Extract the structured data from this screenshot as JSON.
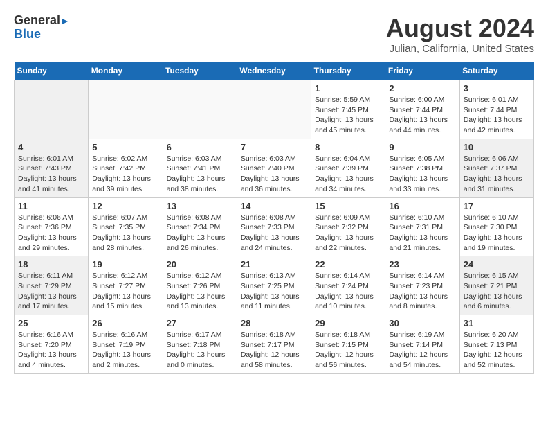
{
  "header": {
    "logo_line1": "General",
    "logo_line2": "Blue",
    "month_year": "August 2024",
    "location": "Julian, California, United States"
  },
  "weekdays": [
    "Sunday",
    "Monday",
    "Tuesday",
    "Wednesday",
    "Thursday",
    "Friday",
    "Saturday"
  ],
  "weeks": [
    [
      {
        "day": "",
        "sunrise": "",
        "sunset": "",
        "daylight": "",
        "empty": true
      },
      {
        "day": "",
        "sunrise": "",
        "sunset": "",
        "daylight": "",
        "empty": true
      },
      {
        "day": "",
        "sunrise": "",
        "sunset": "",
        "daylight": "",
        "empty": true
      },
      {
        "day": "",
        "sunrise": "",
        "sunset": "",
        "daylight": "",
        "empty": true
      },
      {
        "day": "1",
        "sunrise": "Sunrise: 5:59 AM",
        "sunset": "Sunset: 7:45 PM",
        "daylight": "Daylight: 13 hours and 45 minutes.",
        "empty": false
      },
      {
        "day": "2",
        "sunrise": "Sunrise: 6:00 AM",
        "sunset": "Sunset: 7:44 PM",
        "daylight": "Daylight: 13 hours and 44 minutes.",
        "empty": false
      },
      {
        "day": "3",
        "sunrise": "Sunrise: 6:01 AM",
        "sunset": "Sunset: 7:44 PM",
        "daylight": "Daylight: 13 hours and 42 minutes.",
        "empty": false
      }
    ],
    [
      {
        "day": "4",
        "sunrise": "Sunrise: 6:01 AM",
        "sunset": "Sunset: 7:43 PM",
        "daylight": "Daylight: 13 hours and 41 minutes.",
        "empty": false
      },
      {
        "day": "5",
        "sunrise": "Sunrise: 6:02 AM",
        "sunset": "Sunset: 7:42 PM",
        "daylight": "Daylight: 13 hours and 39 minutes.",
        "empty": false
      },
      {
        "day": "6",
        "sunrise": "Sunrise: 6:03 AM",
        "sunset": "Sunset: 7:41 PM",
        "daylight": "Daylight: 13 hours and 38 minutes.",
        "empty": false
      },
      {
        "day": "7",
        "sunrise": "Sunrise: 6:03 AM",
        "sunset": "Sunset: 7:40 PM",
        "daylight": "Daylight: 13 hours and 36 minutes.",
        "empty": false
      },
      {
        "day": "8",
        "sunrise": "Sunrise: 6:04 AM",
        "sunset": "Sunset: 7:39 PM",
        "daylight": "Daylight: 13 hours and 34 minutes.",
        "empty": false
      },
      {
        "day": "9",
        "sunrise": "Sunrise: 6:05 AM",
        "sunset": "Sunset: 7:38 PM",
        "daylight": "Daylight: 13 hours and 33 minutes.",
        "empty": false
      },
      {
        "day": "10",
        "sunrise": "Sunrise: 6:06 AM",
        "sunset": "Sunset: 7:37 PM",
        "daylight": "Daylight: 13 hours and 31 minutes.",
        "empty": false
      }
    ],
    [
      {
        "day": "11",
        "sunrise": "Sunrise: 6:06 AM",
        "sunset": "Sunset: 7:36 PM",
        "daylight": "Daylight: 13 hours and 29 minutes.",
        "empty": false
      },
      {
        "day": "12",
        "sunrise": "Sunrise: 6:07 AM",
        "sunset": "Sunset: 7:35 PM",
        "daylight": "Daylight: 13 hours and 28 minutes.",
        "empty": false
      },
      {
        "day": "13",
        "sunrise": "Sunrise: 6:08 AM",
        "sunset": "Sunset: 7:34 PM",
        "daylight": "Daylight: 13 hours and 26 minutes.",
        "empty": false
      },
      {
        "day": "14",
        "sunrise": "Sunrise: 6:08 AM",
        "sunset": "Sunset: 7:33 PM",
        "daylight": "Daylight: 13 hours and 24 minutes.",
        "empty": false
      },
      {
        "day": "15",
        "sunrise": "Sunrise: 6:09 AM",
        "sunset": "Sunset: 7:32 PM",
        "daylight": "Daylight: 13 hours and 22 minutes.",
        "empty": false
      },
      {
        "day": "16",
        "sunrise": "Sunrise: 6:10 AM",
        "sunset": "Sunset: 7:31 PM",
        "daylight": "Daylight: 13 hours and 21 minutes.",
        "empty": false
      },
      {
        "day": "17",
        "sunrise": "Sunrise: 6:10 AM",
        "sunset": "Sunset: 7:30 PM",
        "daylight": "Daylight: 13 hours and 19 minutes.",
        "empty": false
      }
    ],
    [
      {
        "day": "18",
        "sunrise": "Sunrise: 6:11 AM",
        "sunset": "Sunset: 7:29 PM",
        "daylight": "Daylight: 13 hours and 17 minutes.",
        "empty": false
      },
      {
        "day": "19",
        "sunrise": "Sunrise: 6:12 AM",
        "sunset": "Sunset: 7:27 PM",
        "daylight": "Daylight: 13 hours and 15 minutes.",
        "empty": false
      },
      {
        "day": "20",
        "sunrise": "Sunrise: 6:12 AM",
        "sunset": "Sunset: 7:26 PM",
        "daylight": "Daylight: 13 hours and 13 minutes.",
        "empty": false
      },
      {
        "day": "21",
        "sunrise": "Sunrise: 6:13 AM",
        "sunset": "Sunset: 7:25 PM",
        "daylight": "Daylight: 13 hours and 11 minutes.",
        "empty": false
      },
      {
        "day": "22",
        "sunrise": "Sunrise: 6:14 AM",
        "sunset": "Sunset: 7:24 PM",
        "daylight": "Daylight: 13 hours and 10 minutes.",
        "empty": false
      },
      {
        "day": "23",
        "sunrise": "Sunrise: 6:14 AM",
        "sunset": "Sunset: 7:23 PM",
        "daylight": "Daylight: 13 hours and 8 minutes.",
        "empty": false
      },
      {
        "day": "24",
        "sunrise": "Sunrise: 6:15 AM",
        "sunset": "Sunset: 7:21 PM",
        "daylight": "Daylight: 13 hours and 6 minutes.",
        "empty": false
      }
    ],
    [
      {
        "day": "25",
        "sunrise": "Sunrise: 6:16 AM",
        "sunset": "Sunset: 7:20 PM",
        "daylight": "Daylight: 13 hours and 4 minutes.",
        "empty": false
      },
      {
        "day": "26",
        "sunrise": "Sunrise: 6:16 AM",
        "sunset": "Sunset: 7:19 PM",
        "daylight": "Daylight: 13 hours and 2 minutes.",
        "empty": false
      },
      {
        "day": "27",
        "sunrise": "Sunrise: 6:17 AM",
        "sunset": "Sunset: 7:18 PM",
        "daylight": "Daylight: 13 hours and 0 minutes.",
        "empty": false
      },
      {
        "day": "28",
        "sunrise": "Sunrise: 6:18 AM",
        "sunset": "Sunset: 7:17 PM",
        "daylight": "Daylight: 12 hours and 58 minutes.",
        "empty": false
      },
      {
        "day": "29",
        "sunrise": "Sunrise: 6:18 AM",
        "sunset": "Sunset: 7:15 PM",
        "daylight": "Daylight: 12 hours and 56 minutes.",
        "empty": false
      },
      {
        "day": "30",
        "sunrise": "Sunrise: 6:19 AM",
        "sunset": "Sunset: 7:14 PM",
        "daylight": "Daylight: 12 hours and 54 minutes.",
        "empty": false
      },
      {
        "day": "31",
        "sunrise": "Sunrise: 6:20 AM",
        "sunset": "Sunset: 7:13 PM",
        "daylight": "Daylight: 12 hours and 52 minutes.",
        "empty": false
      }
    ]
  ]
}
